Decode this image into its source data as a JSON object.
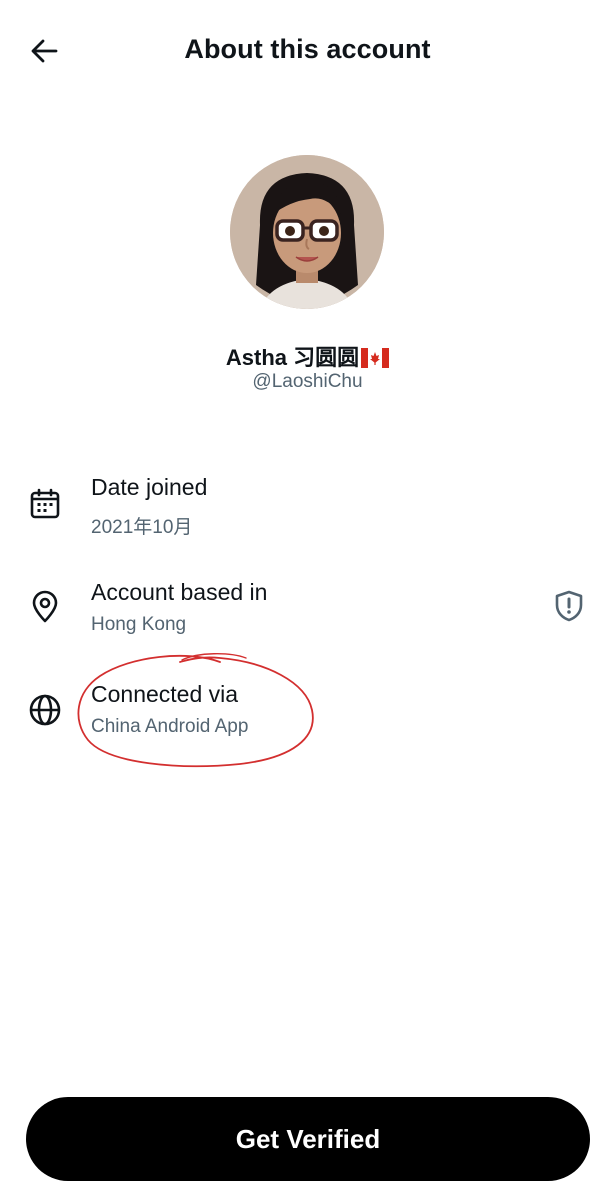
{
  "header": {
    "title": "About this account",
    "back_icon": "arrow-left-icon"
  },
  "profile": {
    "display_name": "Astha 习圆圆",
    "flag": "Canada flag",
    "handle": "@LaoshiChu"
  },
  "details": [
    {
      "icon": "calendar-icon",
      "label": "Date joined",
      "value": "2021年10月"
    },
    {
      "icon": "location-pin-icon",
      "label": "Account based in",
      "value": "Hong Kong",
      "side_icon": "shield-alert-icon"
    },
    {
      "icon": "globe-icon",
      "label": "Connected via",
      "value": "China Android App"
    }
  ],
  "annotation": {
    "color": "#d32f2f",
    "shape": "hand-drawn ellipse"
  },
  "cta": {
    "label": "Get Verified"
  },
  "colors": {
    "text_primary": "#0f1419",
    "text_secondary": "#536471",
    "cta_bg": "#000000",
    "cta_text": "#ffffff"
  }
}
